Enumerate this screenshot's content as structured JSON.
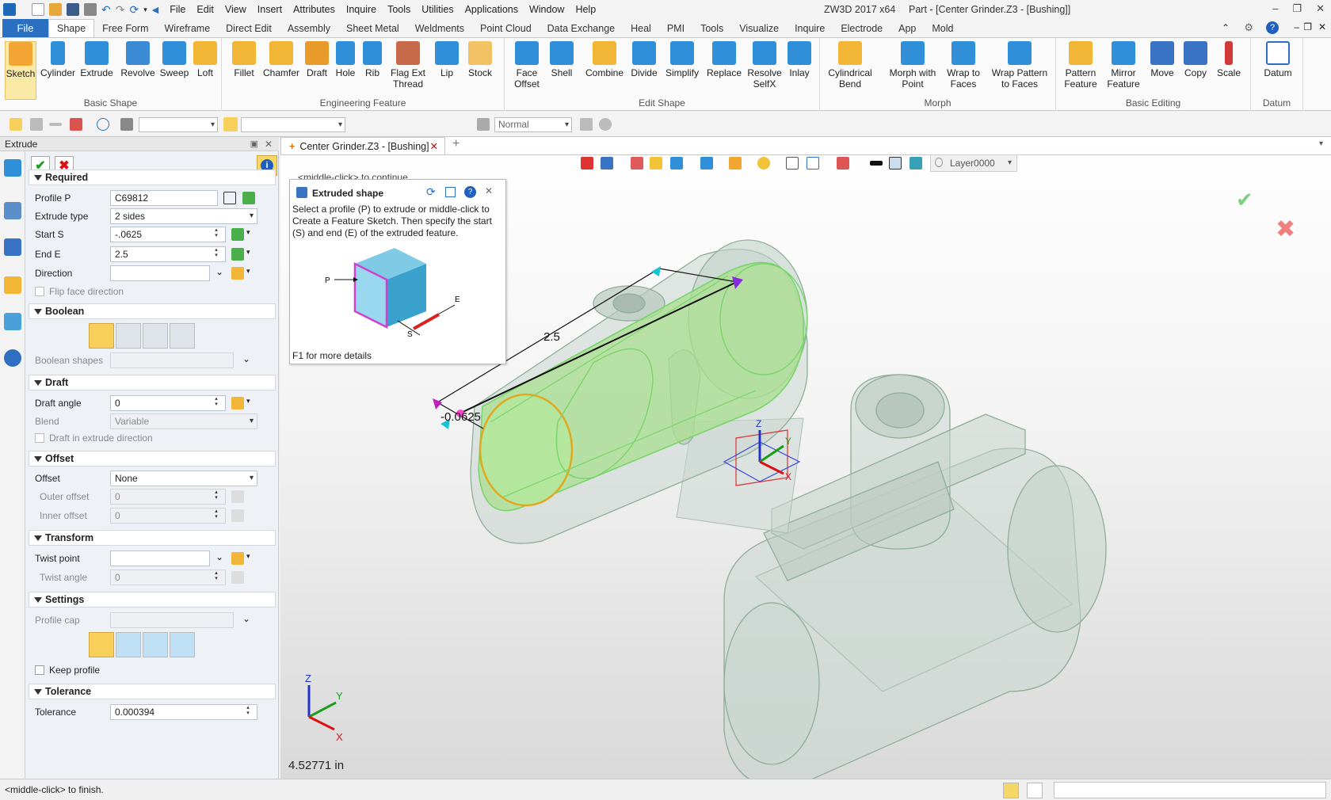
{
  "titlebar": {
    "menus": [
      "File",
      "Edit",
      "View",
      "Insert",
      "Attributes",
      "Inquire",
      "Tools",
      "Utilities",
      "Applications",
      "Window",
      "Help"
    ],
    "app": "ZW3D 2017  x64",
    "doc": "Part - [Center Grinder.Z3 - [Bushing]]"
  },
  "tabs": {
    "file": "File",
    "items": [
      "Shape",
      "Free Form",
      "Wireframe",
      "Direct Edit",
      "Assembly",
      "Sheet Metal",
      "Weldments",
      "Point Cloud",
      "Data Exchange",
      "Heal",
      "PMI",
      "Tools",
      "Visualize",
      "Inquire",
      "Electrode",
      "App",
      "Mold"
    ]
  },
  "ribbon": {
    "groups": [
      "Basic Shape",
      "Engineering Feature",
      "Edit Shape",
      "Morph",
      "Basic Editing",
      "Datum"
    ],
    "buttons": {
      "sketch": "Sketch",
      "cylinder": "Cylinder",
      "extrude": "Extrude",
      "revolve": "Revolve",
      "sweep": "Sweep",
      "loft": "Loft",
      "fillet": "Fillet",
      "chamfer": "Chamfer",
      "draft": "Draft",
      "hole": "Hole",
      "rib": "Rib",
      "flag1": "Flag Ext",
      "flag2": "Thread",
      "lip": "Lip",
      "stock": "Stock",
      "face1": "Face",
      "face2": "Offset",
      "shell": "Shell",
      "combine": "Combine",
      "divide": "Divide",
      "simplify": "Simplify",
      "replace": "Replace",
      "resolve1": "Resolve",
      "resolve2": "SelfX",
      "inlay": "Inlay",
      "cyl1": "Cylindrical",
      "cyl2": "Bend",
      "morph1": "Morph with",
      "morph2": "Point",
      "wrap1": "Wrap to",
      "wrap2": "Faces",
      "wrapp1": "Wrap Pattern",
      "wrapp2": "to Faces",
      "pattern1": "Pattern",
      "pattern2": "Feature",
      "mirror1": "Mirror",
      "mirror2": "Feature",
      "move": "Move",
      "copy": "Copy",
      "scale": "Scale",
      "datum": "Datum"
    }
  },
  "toolbar2": {
    "normal": "Normal"
  },
  "panel": {
    "title": "Extrude",
    "required": {
      "header": "Required",
      "profile_label": "Profile P",
      "profile_value": "C69812",
      "type_label": "Extrude type",
      "type_value": "2 sides",
      "start_label": "Start S",
      "start_value": "-.0625",
      "end_label": "End E",
      "end_value": "2.5",
      "direction_label": "Direction",
      "flip_label": "Flip face direction"
    },
    "boolean": {
      "header": "Boolean",
      "shapes_label": "Boolean shapes"
    },
    "draft": {
      "header": "Draft",
      "angle_label": "Draft angle",
      "angle_value": "0",
      "blend_label": "Blend",
      "blend_value": "Variable",
      "in_dir_label": "Draft in extrude direction"
    },
    "offset": {
      "header": "Offset",
      "offset_label": "Offset",
      "offset_value": "None",
      "outer_label": "Outer offset",
      "outer_value": "0",
      "inner_label": "Inner offset",
      "inner_value": "0"
    },
    "transform": {
      "header": "Transform",
      "twist_point_label": "Twist point",
      "twist_angle_label": "Twist angle",
      "twist_angle_value": "0"
    },
    "settings": {
      "header": "Settings",
      "cap_label": "Profile cap",
      "keep_label": "Keep profile"
    },
    "tolerance": {
      "header": "Tolerance",
      "tol_label": "Tolerance",
      "tol_value": "0.000394"
    }
  },
  "viewport": {
    "doc_tab": "Center Grinder.Z3 - [Bushing]",
    "layer": "Layer0000",
    "hint": "<middle-click> to continue.",
    "dim_end": "2.5",
    "dim_start": "-0.0625",
    "measure": "4.52771 in",
    "axes": {
      "x": "X",
      "y": "Y",
      "z": "Z"
    }
  },
  "tooltip": {
    "title": "Extruded shape",
    "body": "Select a profile (P) to extrude or middle-click to Create a Feature Sketch. Then specify the start (S) and end (E) of the extruded feature.",
    "footer": "F1 for more details",
    "p": "P",
    "e": "E",
    "s": "S"
  },
  "status": {
    "text": "<middle-click> to finish."
  }
}
